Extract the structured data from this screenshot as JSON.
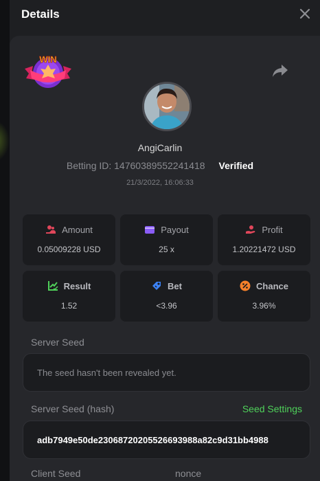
{
  "header": {
    "title": "Details"
  },
  "player": {
    "username": "AngiCarlin",
    "betting_id": "Betting ID: 14760389552241418",
    "verified": "Verified",
    "datetime": "21/3/2022, 16:06:33"
  },
  "badge": {
    "text": "WIN"
  },
  "stats": {
    "amount": {
      "label": "Amount",
      "value": "0.05009228 USD"
    },
    "payout": {
      "label": "Payout",
      "value": "25 x"
    },
    "profit": {
      "label": "Profit",
      "value": "1.20221472 USD"
    },
    "result": {
      "label": "Result",
      "value": "1.52"
    },
    "bet": {
      "label": "Bet",
      "value": "<3.96"
    },
    "chance": {
      "label": "Chance",
      "value": "3.96%"
    }
  },
  "server_seed": {
    "label": "Server Seed",
    "value": "The seed hasn't been revealed yet."
  },
  "server_seed_hash": {
    "label": "Server Seed (hash)",
    "link": "Seed Settings",
    "value": "adb7949e50de23068720205526693988a82c9d31bb4988"
  },
  "client_seed": {
    "label": "Client Seed"
  },
  "nonce": {
    "label": "nonce"
  },
  "icons": {
    "close": "close-icon",
    "share": "share-icon",
    "amount": "coins-icon",
    "payout": "wallet-icon",
    "profit": "hand-coin-icon",
    "result": "chart-check-icon",
    "bet": "tag-icon",
    "chance": "percent-icon"
  },
  "colors": {
    "accent_green": "#4fd15a",
    "amount_icon": "#e0465a",
    "payout_icon": "#8a5cf6",
    "profit_icon": "#e0465a",
    "result_icon": "#4fd15a",
    "bet_icon": "#3b82f6",
    "chance_icon": "#f5802a"
  }
}
